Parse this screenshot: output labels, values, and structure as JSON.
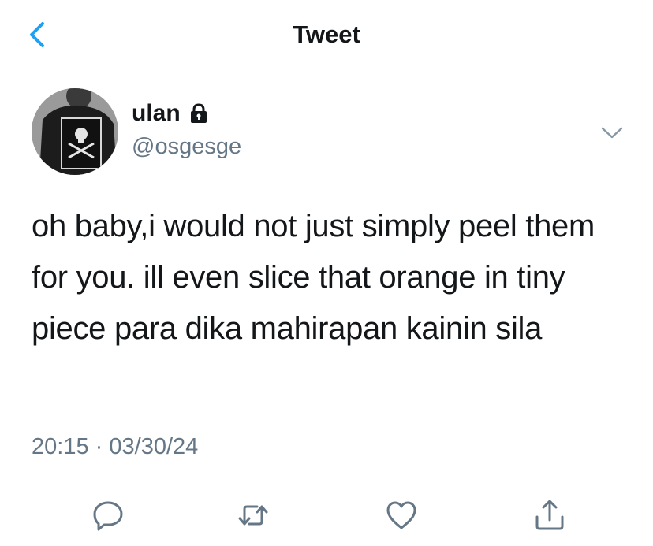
{
  "header": {
    "title": "Tweet"
  },
  "tweet": {
    "display_name": "ulan",
    "handle": "@osgesge",
    "text": "oh baby,i would not just simply peel them for you. ill even slice that orange in tiny piece para dika mahirapan kainin sila",
    "time": "20:15",
    "separator": "·",
    "date": "03/30/24"
  },
  "icons": {
    "back": "chevron-left-icon",
    "lock": "lock-icon",
    "more": "chevron-down-icon",
    "reply": "reply-icon",
    "retweet": "retweet-icon",
    "like": "heart-icon",
    "share": "share-icon"
  },
  "colors": {
    "accent": "#1da1f2",
    "text": "#14171a",
    "secondary": "#657786",
    "icon": "#657786",
    "divider": "#e1e8ed"
  }
}
